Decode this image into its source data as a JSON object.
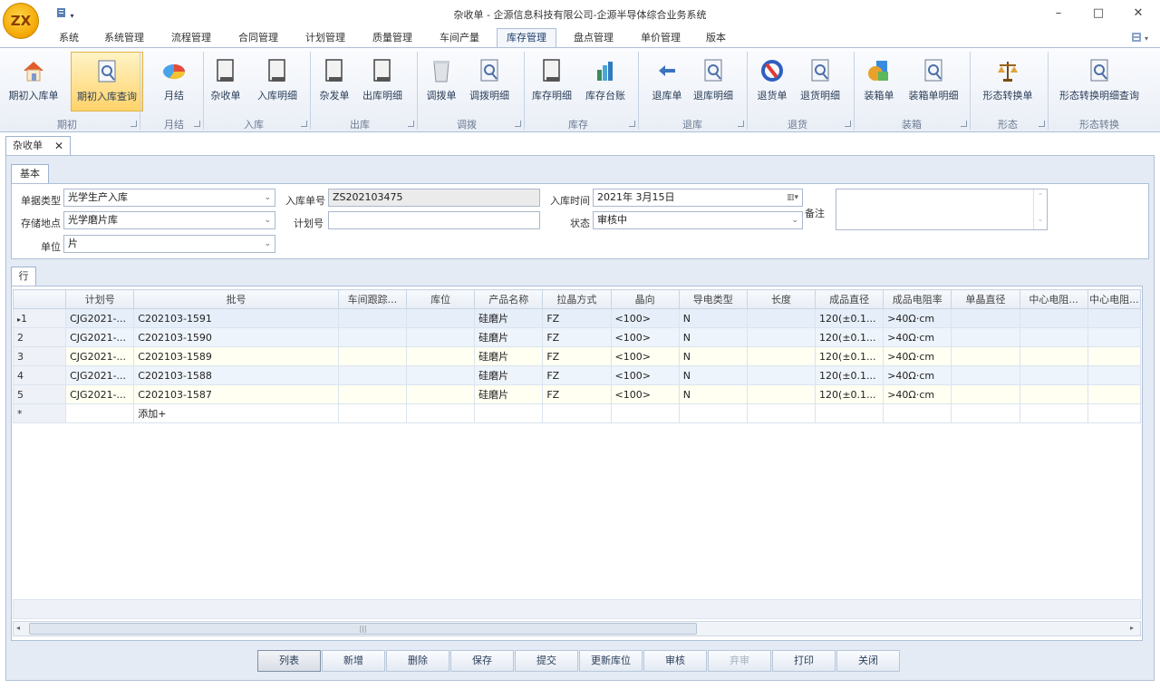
{
  "app": {
    "logo_text": "ZX",
    "window_title": "杂收单 - 企源信息科技有限公司-企源半导体综合业务系统",
    "qat_icon": "document-icon",
    "buttons": {
      "minimize": "–",
      "maximize": "□",
      "close": "✕"
    },
    "right_icon": "grid-icon"
  },
  "menu": {
    "tabs": [
      "系统",
      "系统管理",
      "流程管理",
      "合同管理",
      "计划管理",
      "质量管理",
      "车间产量",
      "库存管理",
      "盘点管理",
      "单价管理",
      "版本"
    ],
    "active": "库存管理"
  },
  "ribbon": {
    "buttons": [
      {
        "label": "期初入库单",
        "icon": "home-icon",
        "highlight": false
      },
      {
        "label": "期初入库查询",
        "icon": "search-document-icon",
        "highlight": true
      },
      {
        "label": "月结",
        "icon": "pie-chart-icon",
        "highlight": false
      },
      {
        "label": "杂收单",
        "icon": "document-icon",
        "highlight": false
      },
      {
        "label": "入库明细",
        "icon": "document-icon",
        "highlight": false
      },
      {
        "label": "杂发单",
        "icon": "document-icon",
        "highlight": false
      },
      {
        "label": "出库明细",
        "icon": "document-icon",
        "highlight": false
      },
      {
        "label": "调拨单",
        "icon": "trash-icon",
        "highlight": false
      },
      {
        "label": "调拨明细",
        "icon": "search-document-icon",
        "highlight": false
      },
      {
        "label": "库存明细",
        "icon": "document-icon",
        "highlight": false
      },
      {
        "label": "库存台账",
        "icon": "bar-chart-icon",
        "highlight": false
      },
      {
        "label": "退库单",
        "icon": "arrow-left-icon",
        "highlight": false
      },
      {
        "label": "退库明细",
        "icon": "search-document-icon",
        "highlight": false
      },
      {
        "label": "退货单",
        "icon": "refresh-icon",
        "highlight": false
      },
      {
        "label": "退货明细",
        "icon": "search-document-icon",
        "highlight": false
      },
      {
        "label": "装箱单",
        "icon": "shapes-icon",
        "highlight": false
      },
      {
        "label": "装箱单明细",
        "icon": "search-document-icon",
        "highlight": false
      },
      {
        "label": "形态转换单",
        "icon": "scale-icon",
        "highlight": false
      },
      {
        "label": "形态转换明细查询",
        "icon": "search-document-icon",
        "highlight": false
      }
    ],
    "groups": [
      "期初",
      "月结",
      "入库",
      "出库",
      "调拨",
      "库存",
      "退库",
      "退货",
      "装箱",
      "形态",
      "形态转换"
    ]
  },
  "doc_tab": {
    "label": "杂收单",
    "close": "✕"
  },
  "form": {
    "section_tab": "基本",
    "doc_type_label": "单据类型",
    "doc_type_value": "光学生产入库",
    "storage_label": "存储地点",
    "storage_value": "光学磨片库",
    "unit_label": "单位",
    "unit_value": "片",
    "doc_no_label": "入库单号",
    "doc_no_value": "ZS202103475",
    "plan_no_label": "计划号",
    "plan_no_value": "",
    "time_label": "入库时间",
    "time_value": "2021年  3月15日",
    "status_label": "状态",
    "status_value": "审核中",
    "remark_label": "备注",
    "remark_value": ""
  },
  "grid": {
    "section_tab": "行",
    "columns": [
      "计划号",
      "批号",
      "车间跟踪...",
      "库位",
      "产品名称",
      "拉晶方式",
      "晶向",
      "导电类型",
      "长度",
      "成品直径",
      "成品电阻率",
      "单晶直径",
      "中心电阻...",
      "中心电阻..."
    ],
    "rows": [
      {
        "num": "1",
        "cells": [
          "CJG2021-...",
          "C202103-1591",
          "",
          "",
          "硅磨片",
          "FZ",
          "<100>",
          "N",
          "",
          "120(±0.1...",
          ">40Ω·cm",
          "",
          "",
          ""
        ]
      },
      {
        "num": "2",
        "cells": [
          "CJG2021-...",
          "C202103-1590",
          "",
          "",
          "硅磨片",
          "FZ",
          "<100>",
          "N",
          "",
          "120(±0.1...",
          ">40Ω·cm",
          "",
          "",
          ""
        ]
      },
      {
        "num": "3",
        "cells": [
          "CJG2021-...",
          "C202103-1589",
          "",
          "",
          "硅磨片",
          "FZ",
          "<100>",
          "N",
          "",
          "120(±0.1...",
          ">40Ω·cm",
          "",
          "",
          ""
        ]
      },
      {
        "num": "4",
        "cells": [
          "CJG2021-...",
          "C202103-1588",
          "",
          "",
          "硅磨片",
          "FZ",
          "<100>",
          "N",
          "",
          "120(±0.1...",
          ">40Ω·cm",
          "",
          "",
          ""
        ]
      },
      {
        "num": "5",
        "cells": [
          "CJG2021-...",
          "C202103-1587",
          "",
          "",
          "硅磨片",
          "FZ",
          "<100>",
          "N",
          "",
          "120(±0.1...",
          ">40Ω·cm",
          "",
          "",
          ""
        ]
      }
    ],
    "current_row_marker": "▸",
    "new_row_marker": "*",
    "add_label": "添加+"
  },
  "actions": [
    {
      "label": "列表",
      "enabled": true
    },
    {
      "label": "新增",
      "enabled": true
    },
    {
      "label": "删除",
      "enabled": true
    },
    {
      "label": "保存",
      "enabled": true
    },
    {
      "label": "提交",
      "enabled": true
    },
    {
      "label": "更新库位",
      "enabled": true
    },
    {
      "label": "审核",
      "enabled": true
    },
    {
      "label": "弃审",
      "enabled": false
    },
    {
      "label": "打印",
      "enabled": true
    },
    {
      "label": "关闭",
      "enabled": true
    }
  ],
  "colors": {
    "accent": "#ffd36a",
    "border": "#aebfd6",
    "panel": "#e4ebf5"
  }
}
